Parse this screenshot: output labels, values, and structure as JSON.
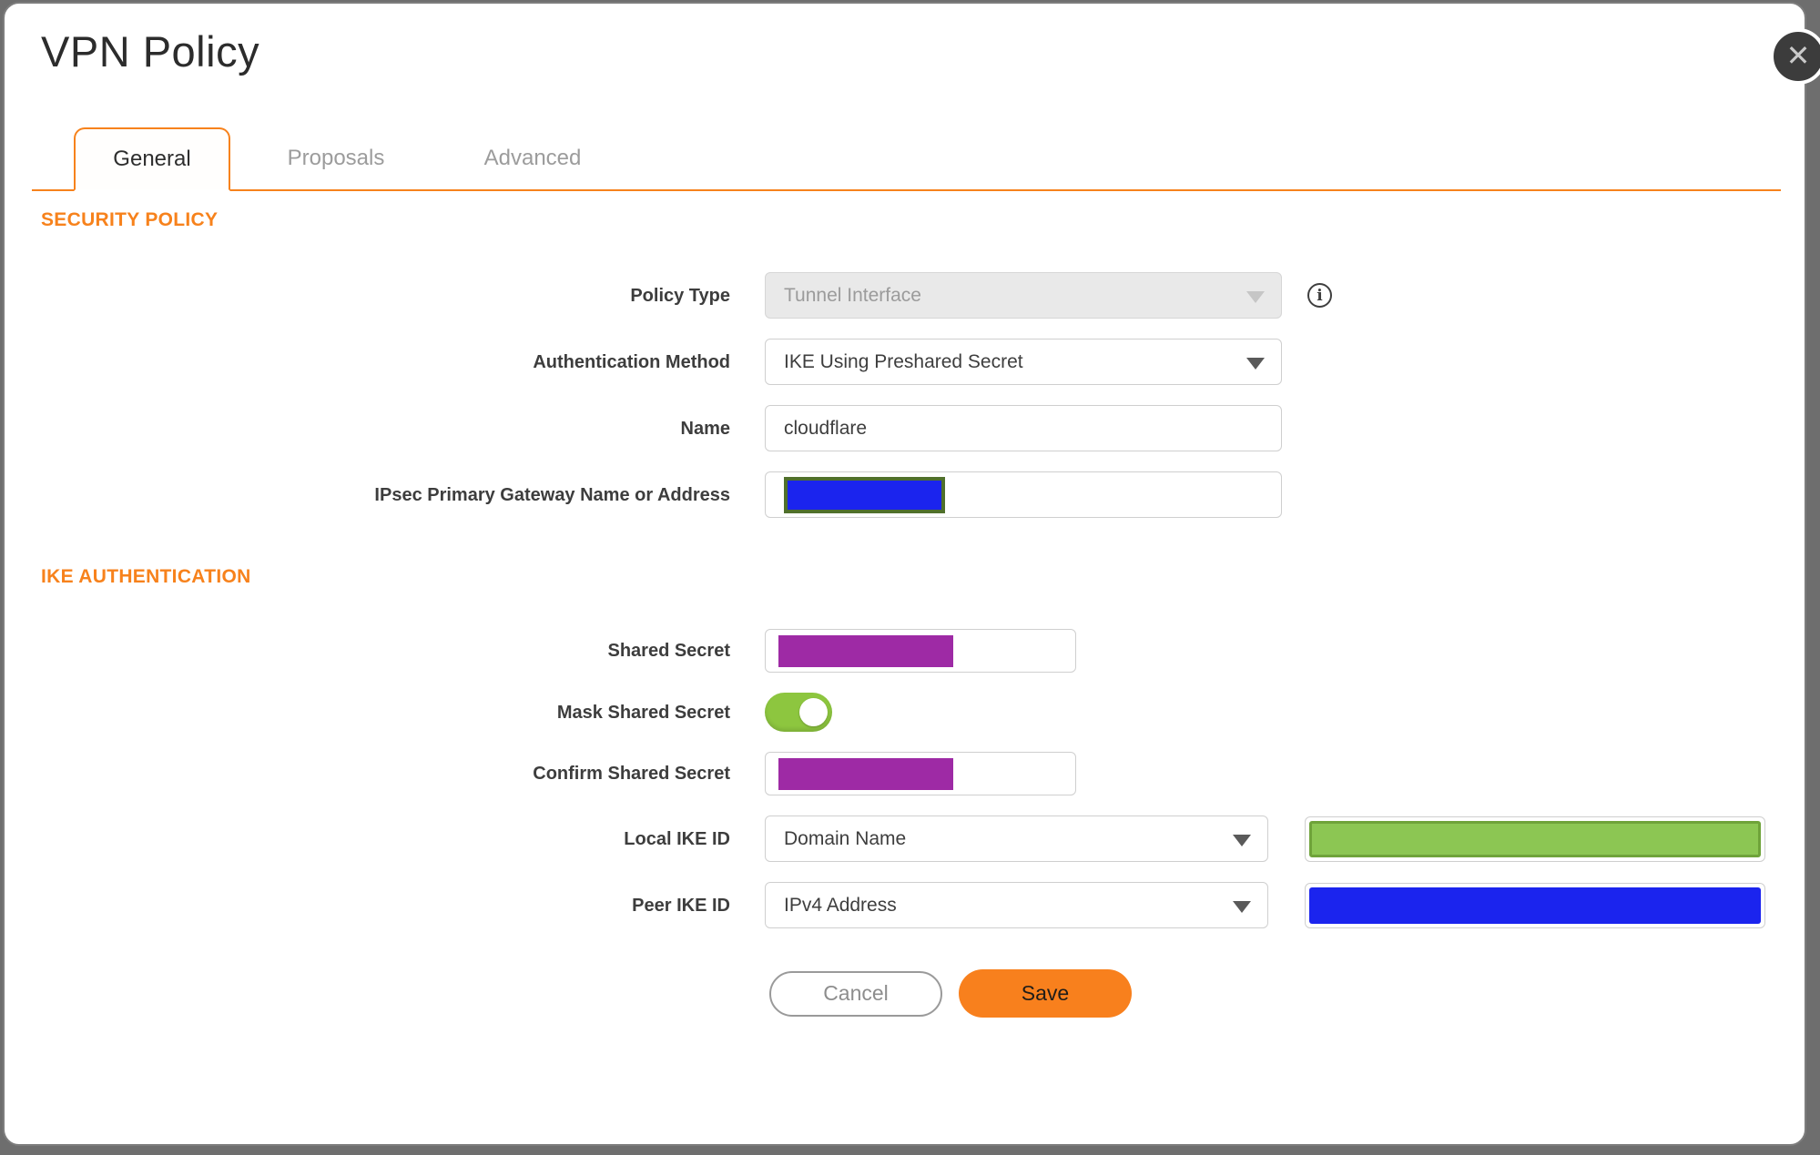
{
  "dialog": {
    "title": "VPN Policy",
    "close_glyph": "✕"
  },
  "tabs": [
    {
      "label": "General",
      "active": true
    },
    {
      "label": "Proposals",
      "active": false
    },
    {
      "label": "Advanced",
      "active": false
    }
  ],
  "icons": {
    "info_glyph": "i"
  },
  "sections": {
    "security_policy": {
      "heading": "SECURITY POLICY",
      "fields": {
        "policy_type": {
          "label": "Policy Type",
          "value": "Tunnel Interface",
          "disabled": true
        },
        "authentication_method": {
          "label": "Authentication Method",
          "value": "IKE Using Preshared Secret"
        },
        "name": {
          "label": "Name",
          "value": "cloudflare"
        },
        "gateway": {
          "label": "IPsec Primary Gateway Name or Address",
          "value_state": "redacted"
        }
      }
    },
    "ike_authentication": {
      "heading": "IKE AUTHENTICATION",
      "fields": {
        "shared_secret": {
          "label": "Shared Secret",
          "value_state": "redacted"
        },
        "mask_shared_secret": {
          "label": "Mask Shared Secret",
          "toggle_on": true
        },
        "confirm_shared_secret": {
          "label": "Confirm Shared Secret",
          "value_state": "redacted"
        },
        "local_ike_id": {
          "label": "Local IKE ID",
          "type_value": "Domain Name",
          "value_state": "redacted"
        },
        "peer_ike_id": {
          "label": "Peer IKE ID",
          "type_value": "IPv4 Address",
          "value_state": "redacted"
        }
      }
    }
  },
  "footer": {
    "cancel_label": "Cancel",
    "save_label": "Save"
  },
  "colors": {
    "accent_orange": "#f7821c",
    "save_orange": "#f8801d",
    "toggle_green": "#8dc63f",
    "secret_purple": "#9e2aa5",
    "redaction_blue": "#1b24ee",
    "redaction_green": "#8cc653",
    "redaction_green_border": "#6fa33a",
    "gateway_border_olive": "#50702c"
  }
}
